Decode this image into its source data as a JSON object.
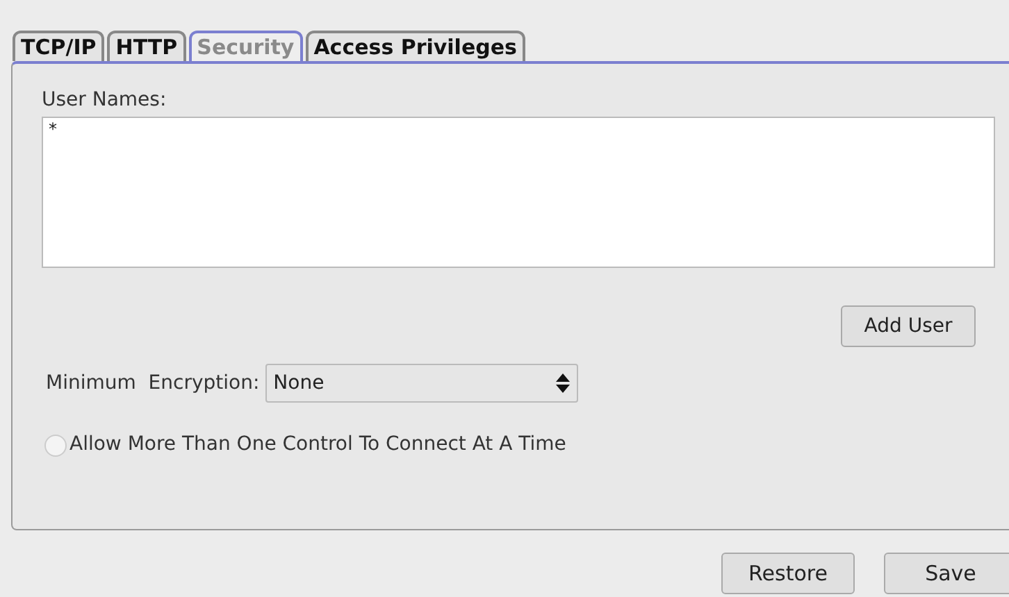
{
  "tabs": [
    {
      "label": "TCP/IP",
      "selected": false
    },
    {
      "label": "HTTP",
      "selected": false
    },
    {
      "label": "Security",
      "selected": true
    },
    {
      "label": "Access Privileges",
      "selected": false
    }
  ],
  "user_names": {
    "label": "User Names:",
    "value": "*"
  },
  "add_user_button": "Add User",
  "encryption": {
    "label": "Minimum  Encryption:",
    "value": "None"
  },
  "allow_multiple": {
    "label": "Allow More Than One Control To Connect At A Time",
    "checked": false
  },
  "buttons": [
    "Restore",
    "Save"
  ]
}
